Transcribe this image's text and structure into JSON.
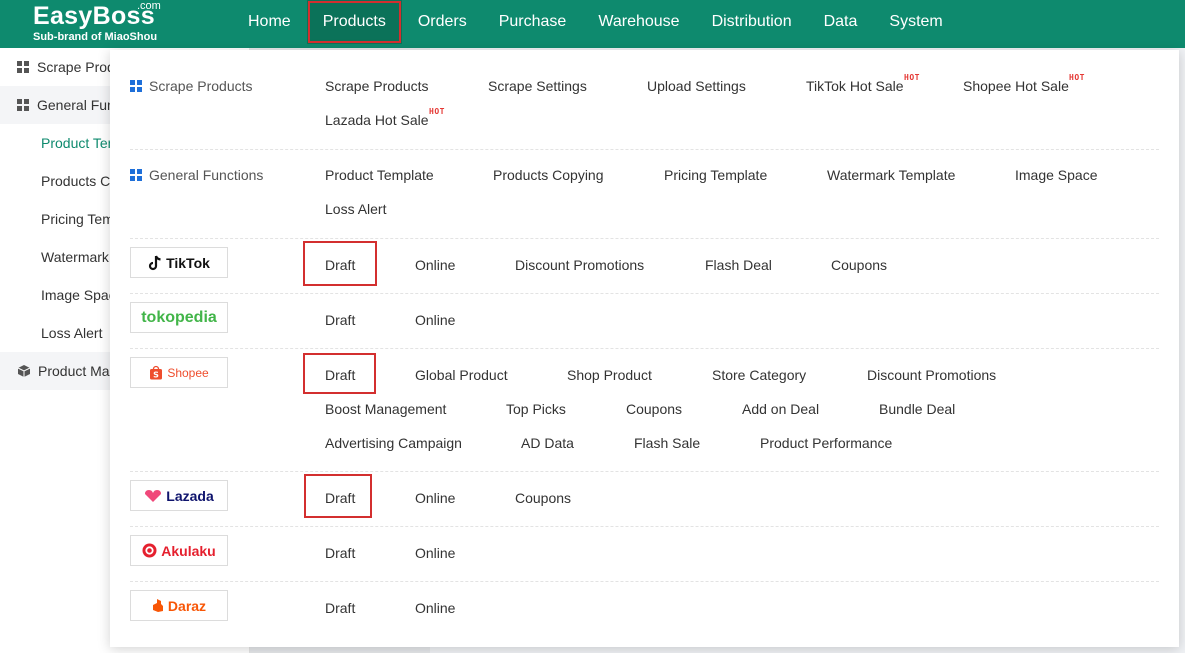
{
  "header": {
    "logo": "EasyBoss",
    "logo_com": ".com",
    "logo_sub": "Sub-brand of MiaoShou",
    "nav": [
      "Home",
      "Products",
      "Orders",
      "Purchase",
      "Warehouse",
      "Distribution",
      "Data",
      "System"
    ]
  },
  "sidebar": {
    "scrape_group": "Scrape Products",
    "general_group": "General Functions",
    "items": [
      "Product Template",
      "Products Copying",
      "Pricing Template",
      "Watermark Template",
      "Image Space",
      "Loss Alert"
    ],
    "management_group": "Product Management"
  },
  "menu": {
    "scrape": {
      "label": "Scrape Products",
      "links": [
        "Scrape Products",
        "Scrape Settings",
        "Upload Settings",
        "TikTok Hot Sale",
        "Shopee Hot Sale",
        "Lazada Hot Sale"
      ],
      "hot": "HOT"
    },
    "general": {
      "label": "General Functions",
      "links": [
        "Product Template",
        "Products Copying",
        "Pricing Template",
        "Watermark Template",
        "Image Space",
        "Loss Alert"
      ]
    },
    "tiktok": {
      "brand": "TikTok",
      "links": [
        "Draft",
        "Online",
        "Discount Promotions",
        "Flash Deal",
        "Coupons"
      ]
    },
    "tokopedia": {
      "brand": "tokopedia",
      "links": [
        "Draft",
        "Online"
      ]
    },
    "shopee": {
      "brand": "Shopee",
      "links": [
        "Draft",
        "Global Product",
        "Shop Product",
        "Store Category",
        "Discount Promotions",
        "Boost Management",
        "Top Picks",
        "Coupons",
        "Add on Deal",
        "Bundle Deal",
        "Advertising Campaign",
        "AD Data",
        "Flash Sale",
        "Product Performance"
      ]
    },
    "lazada": {
      "brand": "Lazada",
      "links": [
        "Draft",
        "Online",
        "Coupons"
      ]
    },
    "akulaku": {
      "brand": "Akulaku",
      "links": [
        "Draft",
        "Online"
      ]
    },
    "daraz": {
      "brand": "Daraz",
      "links": [
        "Draft",
        "Online"
      ]
    }
  },
  "colors": {
    "brand_green": "#0e8a6e",
    "active_nav": "#0b7259",
    "highlight_red": "#d32f2f",
    "hot_red": "#e53935",
    "section_icon_blue": "#1e6fd9",
    "tokopedia_green": "#42b549",
    "shopee_orange": "#ee4d2d",
    "lazada_navy": "#0f146d",
    "lazada_pink": "#f0487a",
    "akulaku_red": "#e5202e",
    "daraz_orange": "#f85606"
  }
}
